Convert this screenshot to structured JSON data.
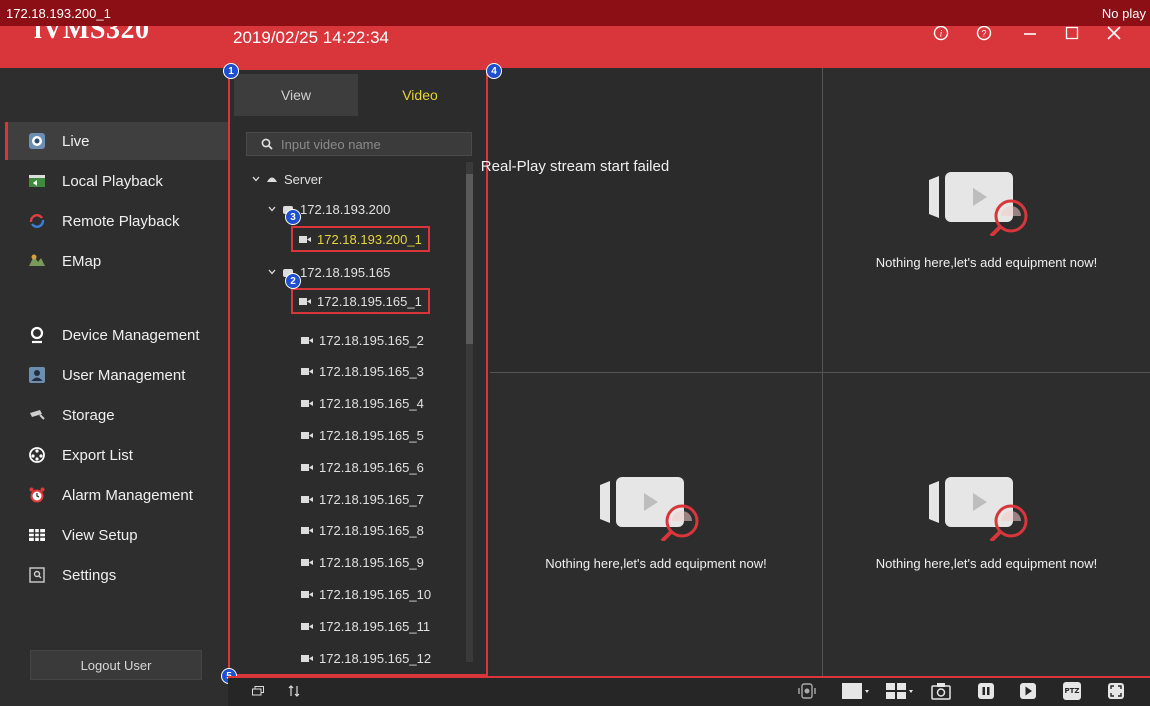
{
  "app": {
    "title": "iVMS320",
    "datetime": "2019/02/25 14:22:34"
  },
  "window_controls": [
    "info-icon",
    "help-icon",
    "minimize-icon",
    "maximize-icon",
    "close-icon"
  ],
  "sidebar": {
    "items": [
      {
        "label": "Live",
        "icon": "live-camera-icon",
        "active": true
      },
      {
        "label": "Local Playback",
        "icon": "local-playback-icon"
      },
      {
        "label": "Remote Playback",
        "icon": "remote-playback-icon"
      },
      {
        "label": "EMap",
        "icon": "map-icon"
      },
      {
        "label": "Device Management",
        "icon": "device-management-icon"
      },
      {
        "label": "User Management",
        "icon": "user-management-icon"
      },
      {
        "label": "Storage",
        "icon": "storage-icon"
      },
      {
        "label": "Export List",
        "icon": "export-list-icon"
      },
      {
        "label": "Alarm Management",
        "icon": "alarm-clock-icon"
      },
      {
        "label": "View Setup",
        "icon": "view-setup-icon"
      },
      {
        "label": "Settings",
        "icon": "settings-icon"
      }
    ],
    "logout_label": "Logout User"
  },
  "resource_panel": {
    "tabs": [
      {
        "label": "View",
        "active": false
      },
      {
        "label": "Video",
        "active": true
      }
    ],
    "search_placeholder": "Input video name",
    "tree": {
      "root": "Server",
      "devices": [
        {
          "name": "172.18.193.200",
          "channels": [
            "172.18.193.200_1"
          ]
        },
        {
          "name": "172.18.195.165",
          "channels": [
            "172.18.195.165_1",
            "172.18.195.165_2",
            "172.18.195.165_3",
            "172.18.195.165_4",
            "172.18.195.165_5",
            "172.18.195.165_6",
            "172.18.195.165_7",
            "172.18.195.165_8",
            "172.18.195.165_9",
            "172.18.195.165_10",
            "172.18.195.165_11",
            "172.18.195.165_12"
          ]
        }
      ]
    }
  },
  "callouts": [
    "1",
    "2",
    "3",
    "4",
    "5"
  ],
  "video_grid": {
    "cell1": {
      "channel": "172.18.193.200_1",
      "status": "No play",
      "message": "Real-Play stream start failed"
    },
    "empty_message": "Nothing here,let's add equipment now!"
  },
  "toolbar": {
    "left": [
      "window-restore-icon",
      "sort-icon"
    ],
    "right": [
      "stream-icon",
      "single-window-icon",
      "split-screen-icon",
      "snapshot-icon",
      "stop-all-icon",
      "play-icon",
      "ptz-icon",
      "fullscreen-icon"
    ],
    "ptz_label": "PTZ"
  },
  "colors": {
    "accent": "#d9363c",
    "selected_text": "#e7d33a",
    "callout": "#1f4fd1",
    "background": "#2b2b2b"
  }
}
